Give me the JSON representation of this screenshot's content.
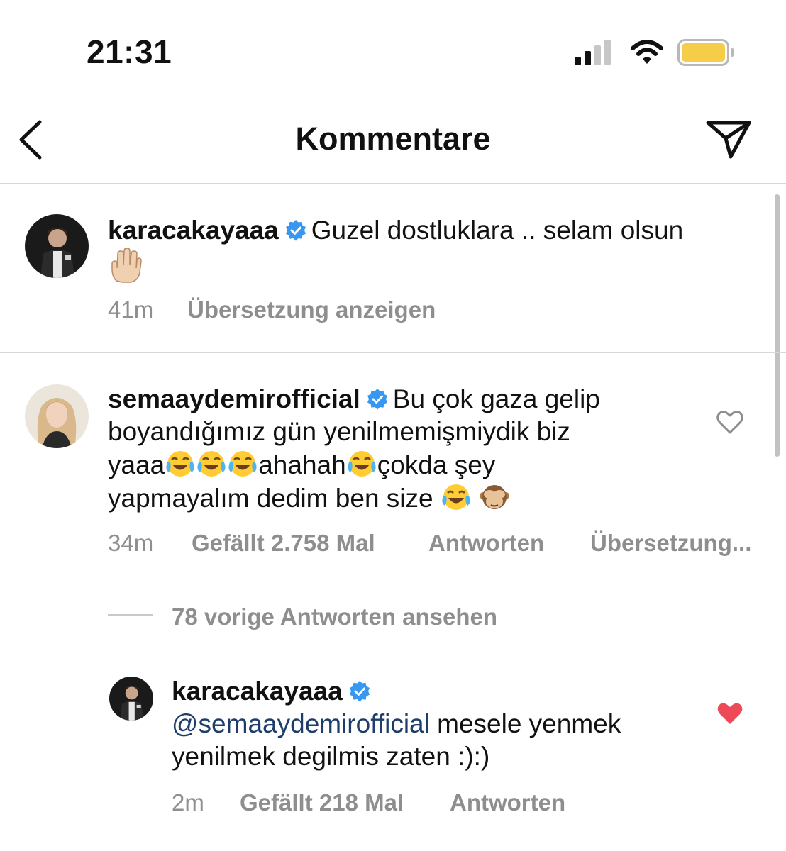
{
  "status_bar": {
    "time": "21:31",
    "battery_color": "#f5cd48"
  },
  "nav": {
    "title": "Kommentare",
    "back_icon": "chevron-left-icon",
    "share_icon": "paper-plane-icon"
  },
  "comments": [
    {
      "username": "karacakayaaa",
      "verified": true,
      "text": "Guzel dostluklara .. selam olsun",
      "emoji": "raised-hand",
      "time": "41m",
      "translate_label": "Übersetzung anzeigen"
    },
    {
      "username": "semaaydemirofficial",
      "verified": true,
      "text_part1": "Bu çok gaza gelip",
      "text_line2": "boyandığımız gün yenilmemişmiydik biz",
      "text_line3_a": "yaaa",
      "text_line3_b": "ahahah",
      "text_line3_c": "çokda şey",
      "text_line4": "yapmayalım dedim ben size",
      "time": "34m",
      "likes": "Gefällt 2.758 Mal",
      "reply_label": "Antworten",
      "translate_label": "Übersetzung...",
      "liked": false
    }
  ],
  "view_replies": "78 vorige Antworten ansehen",
  "reply": {
    "username": "karacakayaaa",
    "verified": true,
    "mention": "@semaaydemirofficial",
    "text_line1": " mesele yenmek",
    "text_line2": "yenilmek degilmis zaten :):)",
    "time": "2m",
    "likes": "Gefällt 218 Mal",
    "reply_label": "Antworten",
    "liked": true,
    "heart_color": "#ed4956"
  },
  "verified_color": "#3897f0"
}
